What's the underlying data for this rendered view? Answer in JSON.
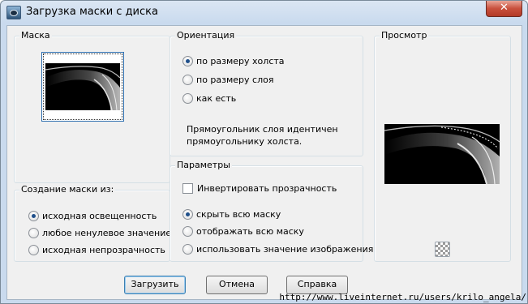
{
  "window": {
    "title": "Загрузка маски с диска",
    "close_label": "✕"
  },
  "mask_group": {
    "title": "Маска"
  },
  "source_group": {
    "title": "Создание маски из:",
    "options": [
      {
        "label": "исходная освещенность",
        "selected": true
      },
      {
        "label": "любое ненулевое значение",
        "selected": false
      },
      {
        "label": "исходная непрозрачность",
        "selected": false
      }
    ]
  },
  "orientation_group": {
    "title": "Ориентация",
    "options": [
      {
        "label": "по размеру холста",
        "selected": true
      },
      {
        "label": "по размеру слоя",
        "selected": false
      },
      {
        "label": "как есть",
        "selected": false
      }
    ],
    "description_line1": "Прямоугольник слоя идентичен",
    "description_line2": "прямоугольнику холста."
  },
  "params_group": {
    "title": "Параметры",
    "invert_label": "Инвертировать прозрачность",
    "invert_checked": false,
    "options": [
      {
        "label": "скрыть всю маску",
        "selected": true
      },
      {
        "label": "отображать всю маску",
        "selected": false
      },
      {
        "label": "использовать значение изображения",
        "selected": false
      }
    ]
  },
  "preview_group": {
    "title": "Просмотр"
  },
  "buttons": {
    "load": "Загрузить",
    "cancel": "Отмена",
    "help": "Справка"
  },
  "watermark": "http://www.liveinternet.ru/users/krilo_angela/"
}
